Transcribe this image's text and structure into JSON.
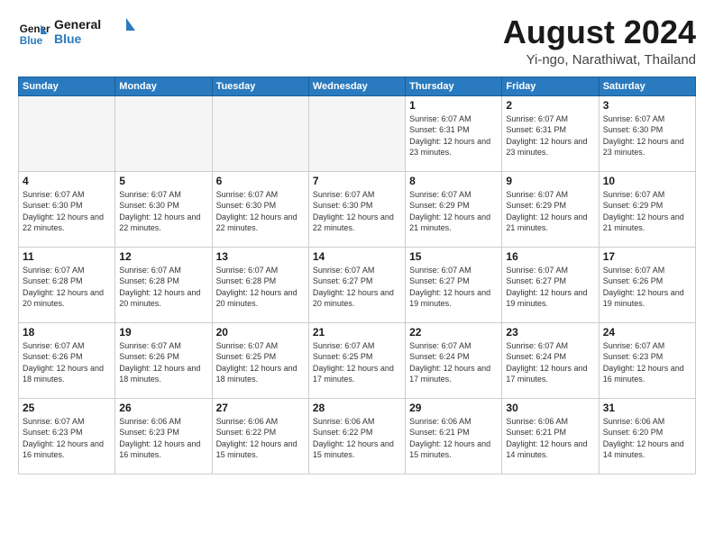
{
  "logo": {
    "text_general": "General",
    "text_blue": "Blue"
  },
  "title": "August 2024",
  "subtitle": "Yi-ngo, Narathiwat, Thailand",
  "weekdays": [
    "Sunday",
    "Monday",
    "Tuesday",
    "Wednesday",
    "Thursday",
    "Friday",
    "Saturday"
  ],
  "weeks": [
    [
      {
        "day": "",
        "info": "",
        "shaded": true
      },
      {
        "day": "",
        "info": "",
        "shaded": true
      },
      {
        "day": "",
        "info": "",
        "shaded": true
      },
      {
        "day": "",
        "info": "",
        "shaded": true
      },
      {
        "day": "1",
        "info": "Sunrise: 6:07 AM\nSunset: 6:31 PM\nDaylight: 12 hours\nand 23 minutes."
      },
      {
        "day": "2",
        "info": "Sunrise: 6:07 AM\nSunset: 6:31 PM\nDaylight: 12 hours\nand 23 minutes."
      },
      {
        "day": "3",
        "info": "Sunrise: 6:07 AM\nSunset: 6:30 PM\nDaylight: 12 hours\nand 23 minutes."
      }
    ],
    [
      {
        "day": "4",
        "info": "Sunrise: 6:07 AM\nSunset: 6:30 PM\nDaylight: 12 hours\nand 22 minutes."
      },
      {
        "day": "5",
        "info": "Sunrise: 6:07 AM\nSunset: 6:30 PM\nDaylight: 12 hours\nand 22 minutes."
      },
      {
        "day": "6",
        "info": "Sunrise: 6:07 AM\nSunset: 6:30 PM\nDaylight: 12 hours\nand 22 minutes."
      },
      {
        "day": "7",
        "info": "Sunrise: 6:07 AM\nSunset: 6:30 PM\nDaylight: 12 hours\nand 22 minutes."
      },
      {
        "day": "8",
        "info": "Sunrise: 6:07 AM\nSunset: 6:29 PM\nDaylight: 12 hours\nand 21 minutes."
      },
      {
        "day": "9",
        "info": "Sunrise: 6:07 AM\nSunset: 6:29 PM\nDaylight: 12 hours\nand 21 minutes."
      },
      {
        "day": "10",
        "info": "Sunrise: 6:07 AM\nSunset: 6:29 PM\nDaylight: 12 hours\nand 21 minutes."
      }
    ],
    [
      {
        "day": "11",
        "info": "Sunrise: 6:07 AM\nSunset: 6:28 PM\nDaylight: 12 hours\nand 20 minutes."
      },
      {
        "day": "12",
        "info": "Sunrise: 6:07 AM\nSunset: 6:28 PM\nDaylight: 12 hours\nand 20 minutes."
      },
      {
        "day": "13",
        "info": "Sunrise: 6:07 AM\nSunset: 6:28 PM\nDaylight: 12 hours\nand 20 minutes."
      },
      {
        "day": "14",
        "info": "Sunrise: 6:07 AM\nSunset: 6:27 PM\nDaylight: 12 hours\nand 20 minutes."
      },
      {
        "day": "15",
        "info": "Sunrise: 6:07 AM\nSunset: 6:27 PM\nDaylight: 12 hours\nand 19 minutes."
      },
      {
        "day": "16",
        "info": "Sunrise: 6:07 AM\nSunset: 6:27 PM\nDaylight: 12 hours\nand 19 minutes."
      },
      {
        "day": "17",
        "info": "Sunrise: 6:07 AM\nSunset: 6:26 PM\nDaylight: 12 hours\nand 19 minutes."
      }
    ],
    [
      {
        "day": "18",
        "info": "Sunrise: 6:07 AM\nSunset: 6:26 PM\nDaylight: 12 hours\nand 18 minutes."
      },
      {
        "day": "19",
        "info": "Sunrise: 6:07 AM\nSunset: 6:26 PM\nDaylight: 12 hours\nand 18 minutes."
      },
      {
        "day": "20",
        "info": "Sunrise: 6:07 AM\nSunset: 6:25 PM\nDaylight: 12 hours\nand 18 minutes."
      },
      {
        "day": "21",
        "info": "Sunrise: 6:07 AM\nSunset: 6:25 PM\nDaylight: 12 hours\nand 17 minutes."
      },
      {
        "day": "22",
        "info": "Sunrise: 6:07 AM\nSunset: 6:24 PM\nDaylight: 12 hours\nand 17 minutes."
      },
      {
        "day": "23",
        "info": "Sunrise: 6:07 AM\nSunset: 6:24 PM\nDaylight: 12 hours\nand 17 minutes."
      },
      {
        "day": "24",
        "info": "Sunrise: 6:07 AM\nSunset: 6:23 PM\nDaylight: 12 hours\nand 16 minutes."
      }
    ],
    [
      {
        "day": "25",
        "info": "Sunrise: 6:07 AM\nSunset: 6:23 PM\nDaylight: 12 hours\nand 16 minutes."
      },
      {
        "day": "26",
        "info": "Sunrise: 6:06 AM\nSunset: 6:23 PM\nDaylight: 12 hours\nand 16 minutes."
      },
      {
        "day": "27",
        "info": "Sunrise: 6:06 AM\nSunset: 6:22 PM\nDaylight: 12 hours\nand 15 minutes."
      },
      {
        "day": "28",
        "info": "Sunrise: 6:06 AM\nSunset: 6:22 PM\nDaylight: 12 hours\nand 15 minutes."
      },
      {
        "day": "29",
        "info": "Sunrise: 6:06 AM\nSunset: 6:21 PM\nDaylight: 12 hours\nand 15 minutes."
      },
      {
        "day": "30",
        "info": "Sunrise: 6:06 AM\nSunset: 6:21 PM\nDaylight: 12 hours\nand 14 minutes."
      },
      {
        "day": "31",
        "info": "Sunrise: 6:06 AM\nSunset: 6:20 PM\nDaylight: 12 hours\nand 14 minutes."
      }
    ]
  ]
}
